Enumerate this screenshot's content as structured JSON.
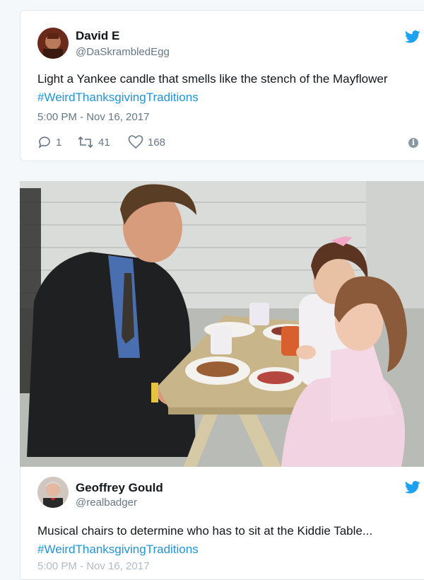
{
  "tweet1": {
    "author_name": "David E",
    "handle": "@DaSkrambledEgg",
    "text_plain": "Light a Yankee candle that smells like the stench of the Mayflower ",
    "hashtag": "#WeirdThanksgivingTraditions",
    "timestamp": "5:00 PM - Nov 16, 2017",
    "replies": "1",
    "retweets": "41",
    "likes": "168",
    "icons": [
      "twitter-bird-icon",
      "reply-icon",
      "retweet-icon",
      "like-heart-icon",
      "info-icon"
    ]
  },
  "photo": {
    "description_icon": "photo"
  },
  "tweet2": {
    "author_name": "Geoffrey Gould",
    "handle": "@realbadger",
    "text_plain": "Musical chairs to determine who has to sit at the Kiddie Table...",
    "hashtag": "#WeirdThanksgivingTraditions",
    "timestamp": "5:00 PM - Nov 16, 2017"
  },
  "colors": {
    "link": "#1b95e0",
    "twitter_blue": "#1da1f2",
    "muted": "#657786"
  }
}
